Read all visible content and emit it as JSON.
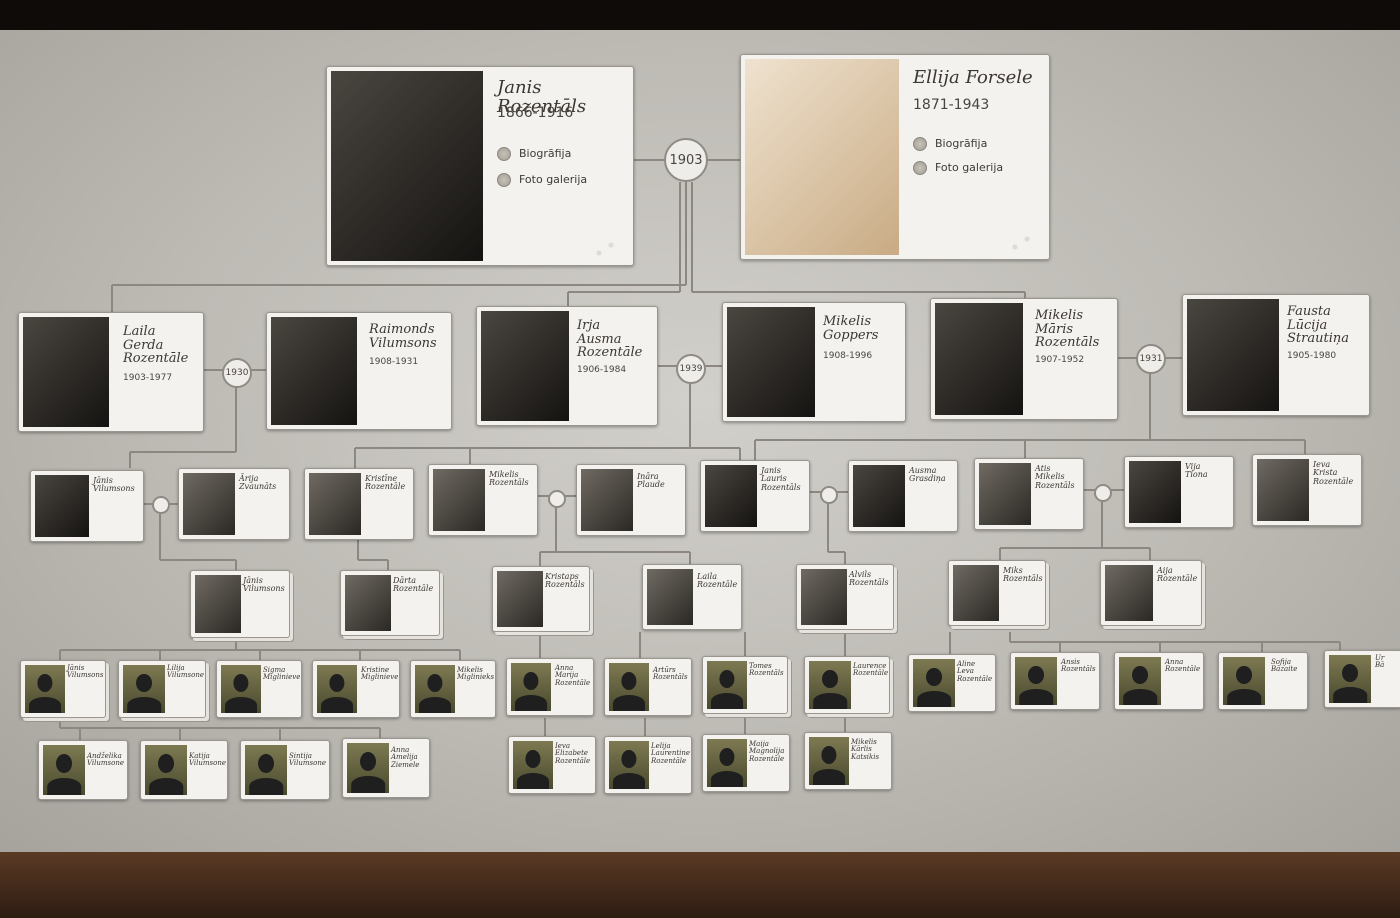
{
  "founders": [
    {
      "name": "Janis Rozentāls",
      "years": "1866-1916",
      "links": [
        "Biogrāfija",
        "Foto galerija"
      ],
      "photo": "bw"
    },
    {
      "name": "Ellija Forsele",
      "years": "1871-1943",
      "links": [
        "Biogrāfija",
        "Foto galerija"
      ],
      "photo": "sepia"
    }
  ],
  "marriages": [
    "1903",
    "1930",
    "1939",
    "1931"
  ],
  "children": [
    {
      "name": "Laila\nGerda\nRozentāle",
      "years": "1903-1977",
      "photo": "bw"
    },
    {
      "name": "Raimonds\nVilumsons",
      "years": "1908-1931",
      "photo": "bw"
    },
    {
      "name": "Irja\nAusma\nRozentāle",
      "years": "1906-1984",
      "photo": "bw"
    },
    {
      "name": "Mikelis\nGoppers",
      "years": "1908-1996",
      "photo": "bw"
    },
    {
      "name": "Mikelis\nMāris\nRozentāls",
      "years": "1907-1952",
      "photo": "bw"
    },
    {
      "name": "Fausta\nLūcija\nStrautiņa",
      "years": "1905-1980",
      "photo": "bw"
    }
  ],
  "gen3": [
    {
      "name": "Jānis\nVilumsons",
      "photo": "bw"
    },
    {
      "name": "Ārija\nZvaunāts",
      "photo": "color"
    },
    {
      "name": "Kristīne\nRozentāle",
      "photo": "color"
    },
    {
      "name": "Mikelis\nRozentāls",
      "photo": "color"
    },
    {
      "name": "Ināra\nPlaude",
      "photo": "color"
    },
    {
      "name": "Janis\nLauris\nRozentāls",
      "photo": "bw"
    },
    {
      "name": "Ausma\nGrasdiņa",
      "photo": "bw"
    },
    {
      "name": "Atis\nMikelis\nRozentāls",
      "photo": "color"
    },
    {
      "name": "Vija\nTiona",
      "photo": "bw"
    },
    {
      "name": "Ieva\nKrista\nRozentāle",
      "photo": "color"
    }
  ],
  "gen4": [
    {
      "name": "Jānis\nVilumsons",
      "photo": "color"
    },
    {
      "name": "Dārta\nRozentāle",
      "photo": "color"
    },
    {
      "name": "Kristaps\nRozentāls",
      "photo": "color"
    },
    {
      "name": "Laila\nRozentāle",
      "photo": "color"
    },
    {
      "name": "Alvils\nRozentāls",
      "photo": "color"
    },
    {
      "name": "Miks\nRozentāls",
      "photo": "color"
    },
    {
      "name": "Aija\nRozentāle",
      "photo": "color"
    }
  ],
  "gen5": [
    {
      "name": "Jānis\nVilumsons"
    },
    {
      "name": "Lilija\nVilumsone"
    },
    {
      "name": "Sigma\nMiglinieve"
    },
    {
      "name": "Kristine\nMiglinieve"
    },
    {
      "name": "Mikelis\nMiglinieks"
    },
    {
      "name": "Anna\nMarija\nRozentāle"
    },
    {
      "name": "Artūrs\nRozentāls"
    },
    {
      "name": "Tomes\nRozentāls"
    },
    {
      "name": "Laurence\nRozentāle"
    },
    {
      "name": "Aline\nLeva\nRozentāle"
    },
    {
      "name": "Ansis\nRozentāls"
    },
    {
      "name": "Anna\nRozentāle"
    },
    {
      "name": "Sofija\nBāzaite"
    },
    {
      "name": "Ur\nBā"
    }
  ],
  "gen6": [
    {
      "name": "Andželika\nVilumsone"
    },
    {
      "name": "Katija\nVilumsone"
    },
    {
      "name": "Sintija\nVilumsone"
    },
    {
      "name": "Anna\nAmelija\nZiemele"
    },
    {
      "name": "Ieva\nElizabete\nRozentāle"
    },
    {
      "name": "Lelija\nLaurentine\nRozentāle"
    },
    {
      "name": "Maija\nMagnolija\nRozentāle"
    },
    {
      "name": "Mikelis\nKārlis\nKatsikis"
    }
  ]
}
